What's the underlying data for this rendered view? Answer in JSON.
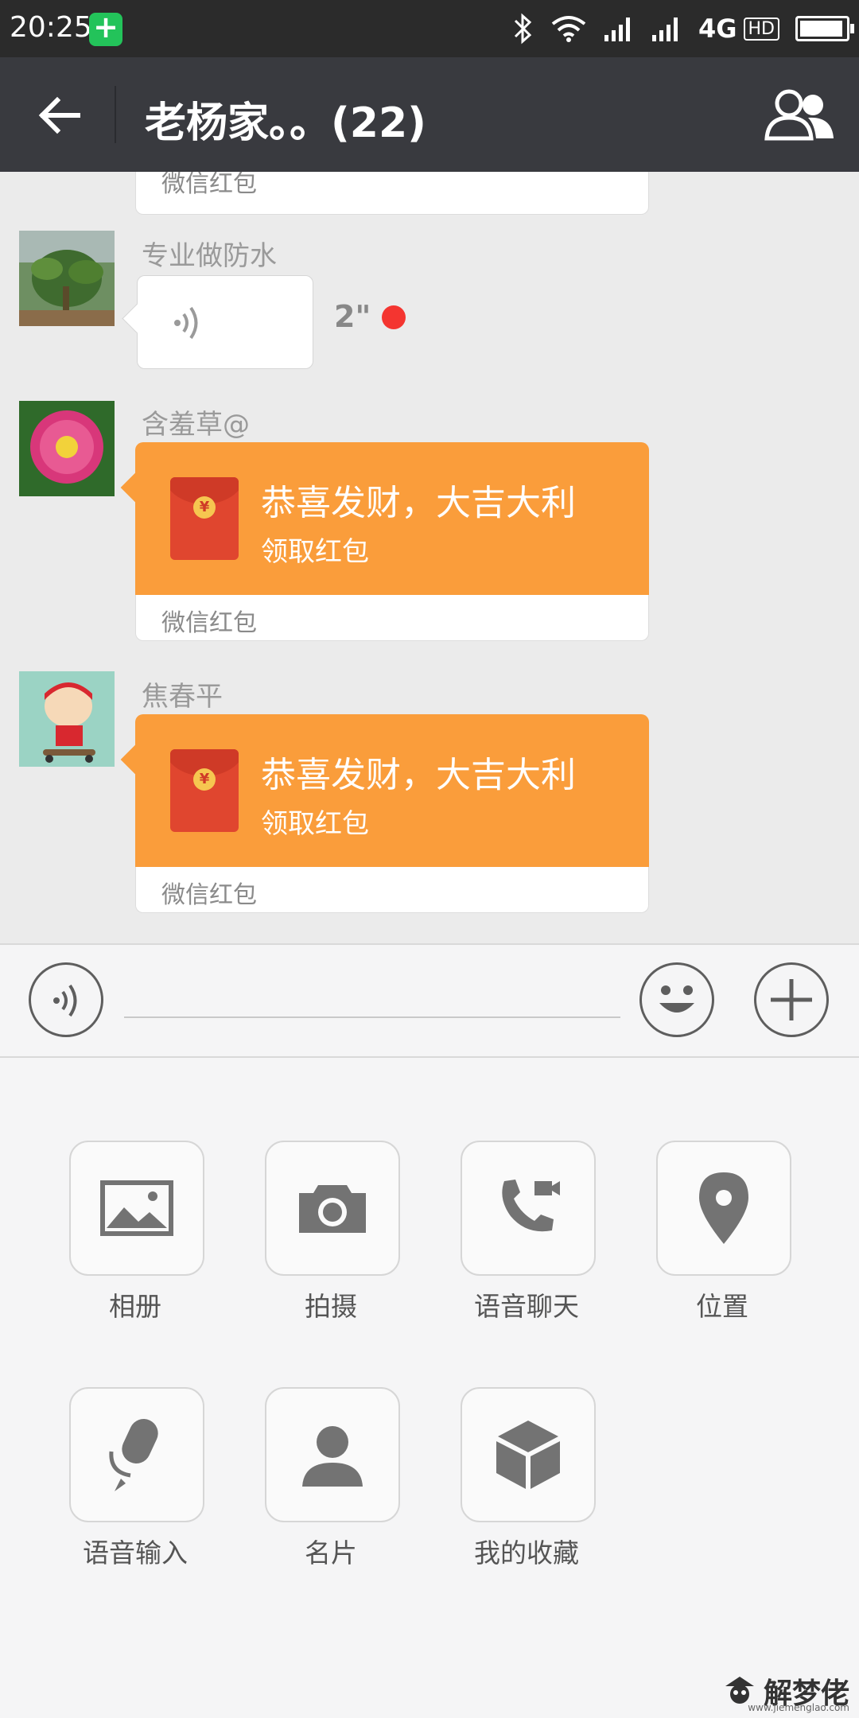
{
  "status_bar": {
    "time": "20:25",
    "network": "4G",
    "hd": "HD",
    "battery_level": 0.95
  },
  "header": {
    "title": "老杨家。。(22)"
  },
  "messages": [
    {
      "type": "redpacket_tail",
      "label": "微信红包"
    },
    {
      "type": "voice",
      "sender": "专业做防水",
      "duration": "2\"",
      "unread": true
    },
    {
      "type": "redpacket",
      "sender": "含羞草@",
      "title": "恭喜发财，大吉大利",
      "subtitle": "领取红包",
      "label": "微信红包"
    },
    {
      "type": "redpacket",
      "sender": "焦春平",
      "title": "恭喜发财，大吉大利",
      "subtitle": "领取红包",
      "label": "微信红包"
    }
  ],
  "input_bar": {
    "value": ""
  },
  "tools": [
    {
      "label": "相册",
      "icon": "album-icon"
    },
    {
      "label": "拍摄",
      "icon": "camera-icon"
    },
    {
      "label": "语音聊天",
      "icon": "voice-call-icon"
    },
    {
      "label": "位置",
      "icon": "location-icon"
    },
    {
      "label": "语音输入",
      "icon": "microphone-icon"
    },
    {
      "label": "名片",
      "icon": "contact-card-icon"
    },
    {
      "label": "我的收藏",
      "icon": "favorites-icon"
    }
  ],
  "watermark": {
    "text": "解梦佬",
    "url": "www.jiemenglao.com"
  },
  "colors": {
    "titlebar": "#393a3f",
    "redpacket": "#fa9d3b",
    "unread": "#f43530"
  }
}
